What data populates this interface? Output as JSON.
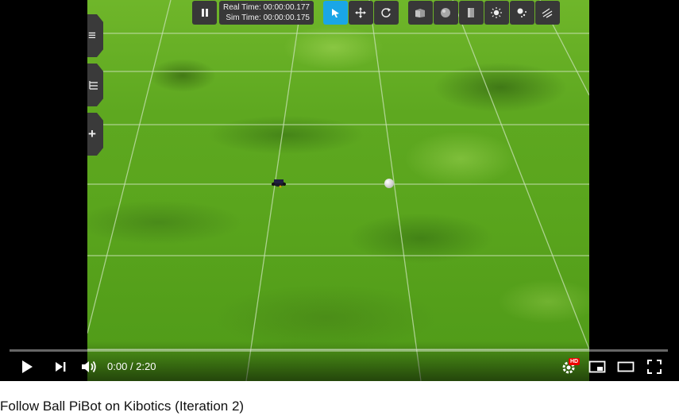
{
  "simulator": {
    "real_time_label": "Real Time:",
    "real_time_value": "00:00:00.177",
    "sim_time_label": "Sim Time:",
    "sim_time_value": "00:00:00.175",
    "accent_color": "#1aa6e6"
  },
  "toolbar": {
    "pause_icon": "pause-icon",
    "modes": [
      "select-arrow-icon",
      "translate-icon",
      "rotate-icon"
    ],
    "shapes": [
      "box-icon",
      "sphere-icon",
      "cylinder-icon",
      "point-light-icon",
      "spot-light-icon",
      "directional-light-icon"
    ]
  },
  "side_tabs": [
    "menu-icon",
    "tree-icon",
    "plus-icon"
  ],
  "player": {
    "current_time": "0:00",
    "duration": "2:20",
    "progress": 0,
    "hd_badge": "HD"
  },
  "video": {
    "title": "Follow Ball PiBot on Kibotics (Iteration 2)"
  }
}
